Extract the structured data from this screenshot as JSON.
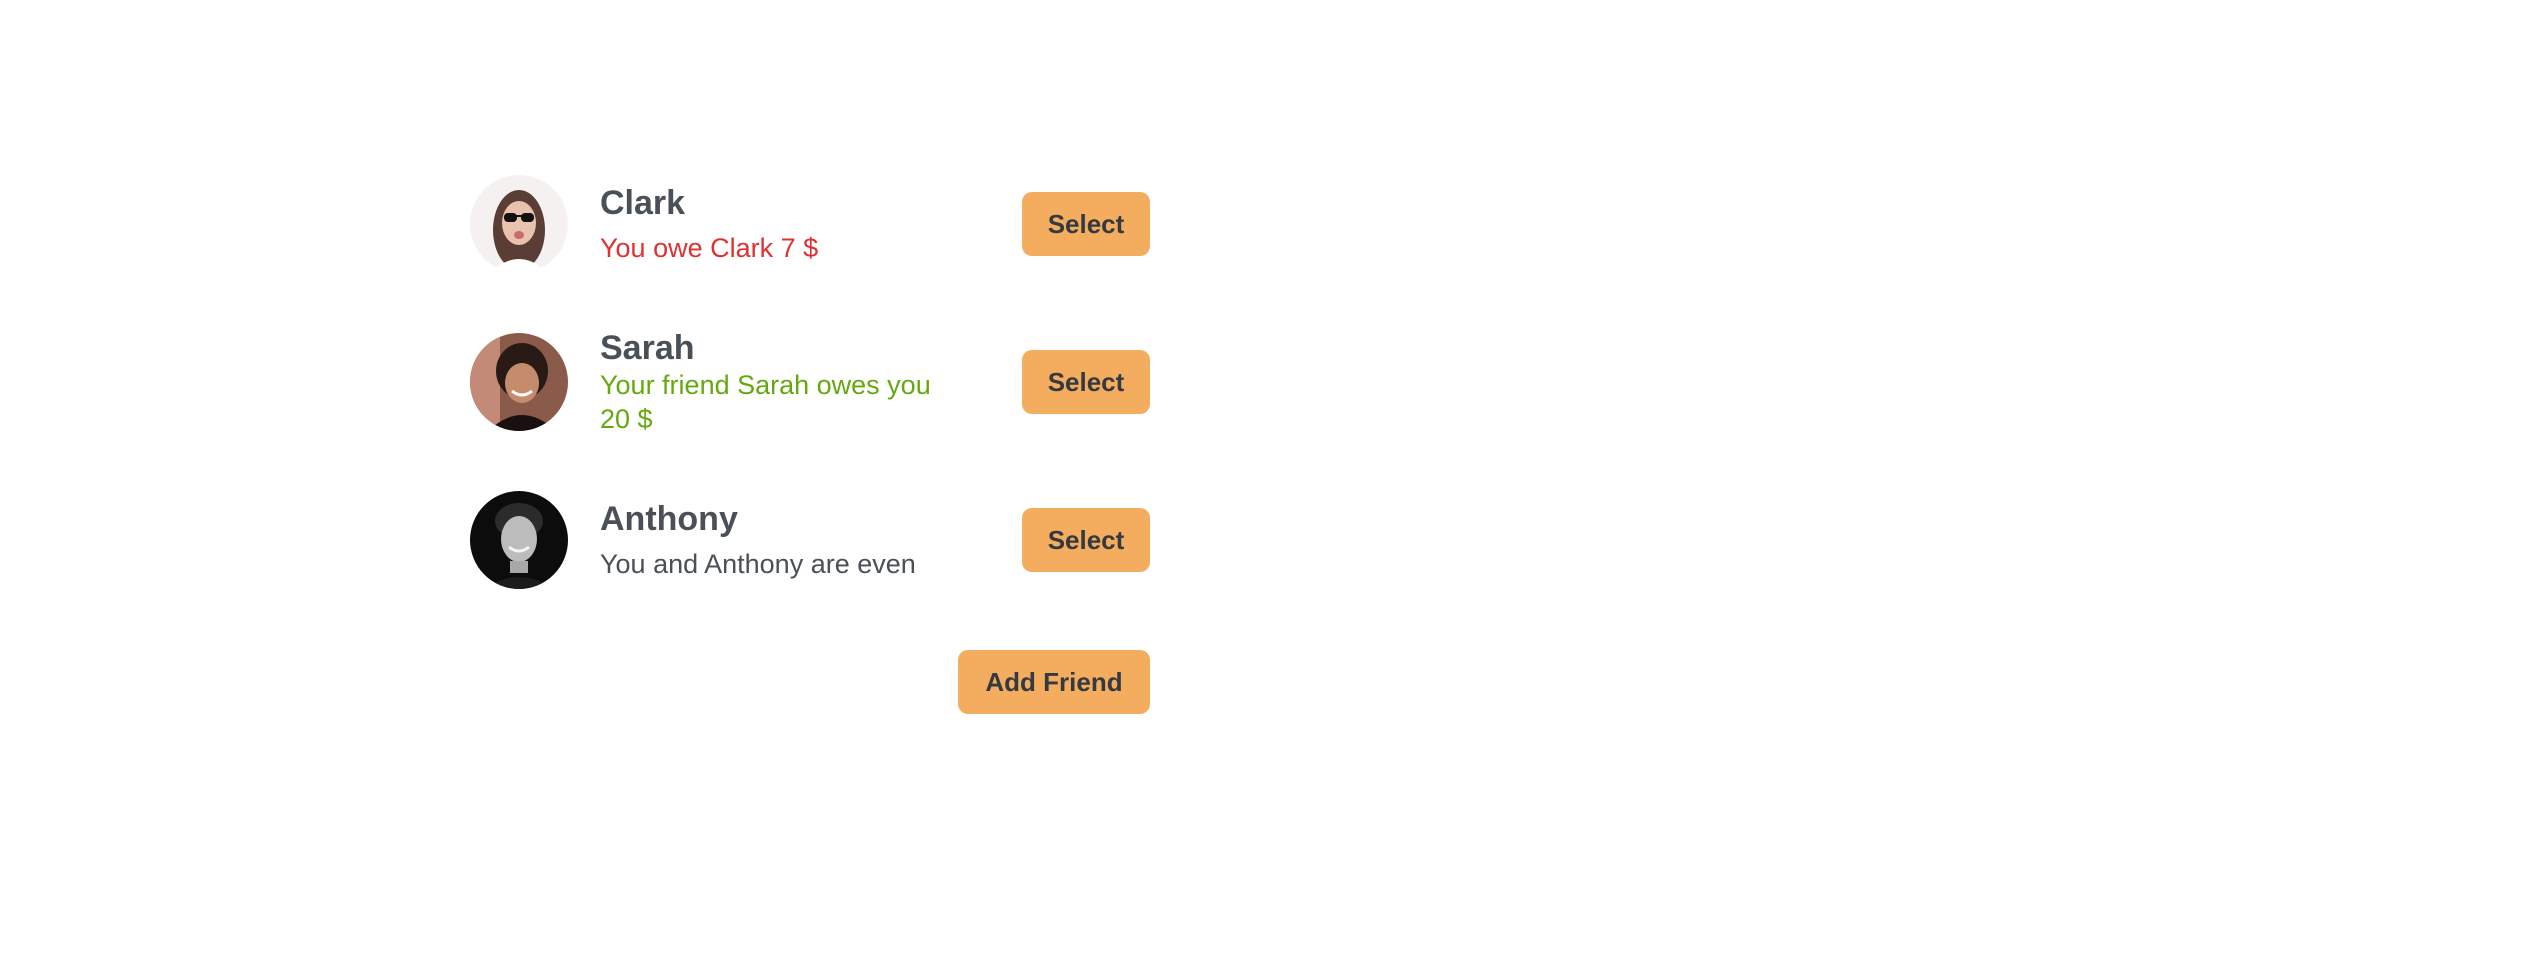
{
  "friends": [
    {
      "name": "Clark",
      "balance_text": "You owe Clark 7 $",
      "balance_status": "owe",
      "balance_color": "#e03131",
      "select_label": "Select",
      "avatar_icon": "person-sunglasses-avatar"
    },
    {
      "name": "Sarah",
      "balance_text": "Your friend Sarah owes you 20 $",
      "balance_status": "owed",
      "balance_color": "#66a80f",
      "select_label": "Select",
      "avatar_icon": "person-smiling-avatar"
    },
    {
      "name": "Anthony",
      "balance_text": "You and Anthony are even",
      "balance_status": "even",
      "balance_color": "#495057",
      "select_label": "Select",
      "avatar_icon": "person-grayscale-avatar"
    }
  ],
  "add_friend": {
    "label": "Add Friend"
  },
  "colors": {
    "button_bg": "#f4ad5f",
    "button_text": "#343a40",
    "text": "#495057"
  }
}
